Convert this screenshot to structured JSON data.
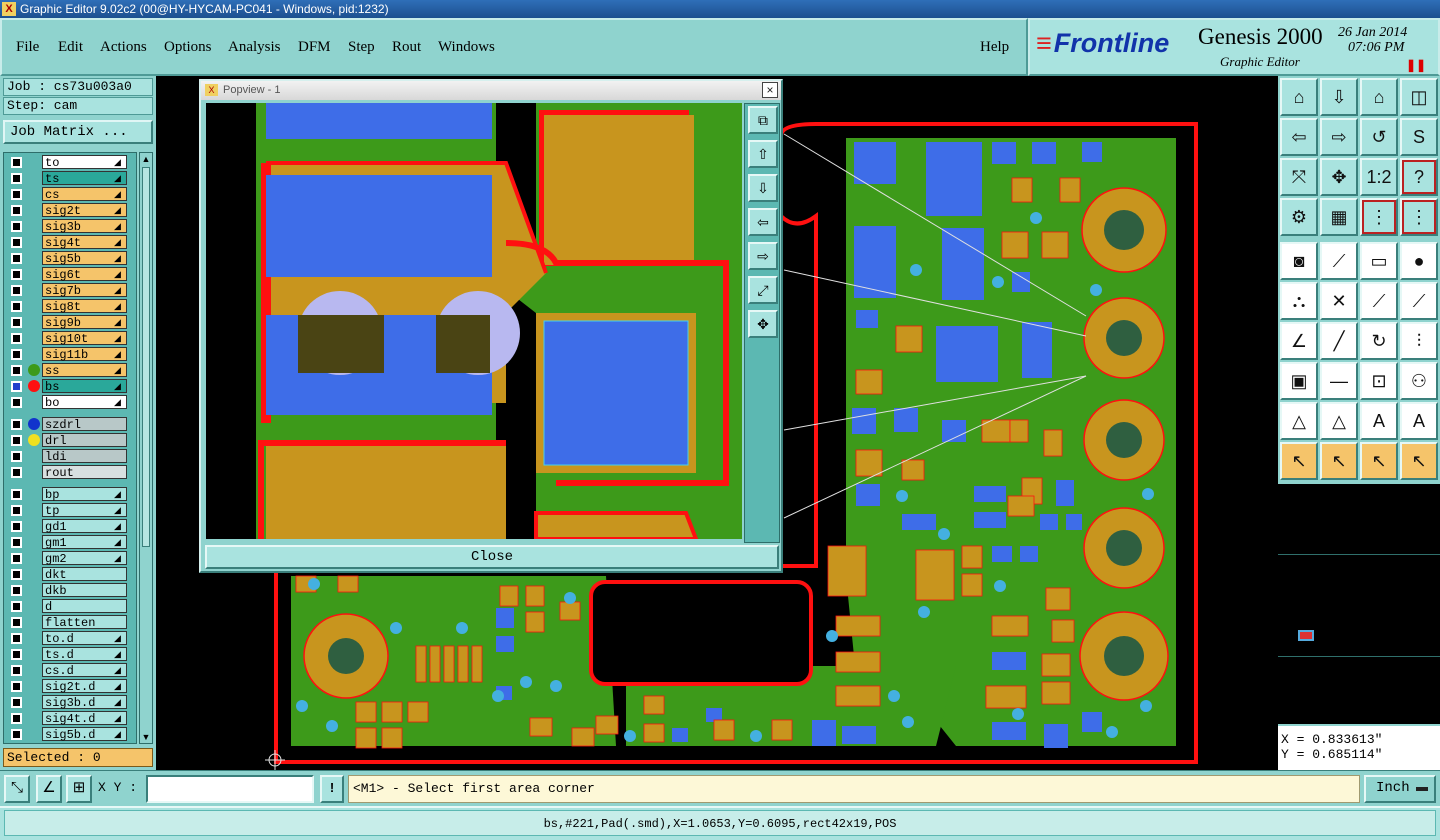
{
  "window": {
    "title": "Graphic Editor 9.02c2 (00@HY-HYCAM-PC041 - Windows, pid:1232)"
  },
  "menu": {
    "file": "File",
    "edit": "Edit",
    "actions": "Actions",
    "options": "Options",
    "analysis": "Analysis",
    "dfm": "DFM",
    "step": "Step",
    "rout": "Rout",
    "windows": "Windows",
    "help": "Help"
  },
  "brand": {
    "logo": "Frontline",
    "product": "Genesis 2000",
    "subtitle": "Graphic Editor",
    "date": "26 Jan 2014",
    "time": "07:06 PM"
  },
  "job": {
    "job_line": "Job : cs73u003a0",
    "step_line": "Step: cam",
    "matrix_button": "Job Matrix ..."
  },
  "layers": [
    {
      "name": "to",
      "color": "#ffffff"
    },
    {
      "name": "ts",
      "color": "#2aa89a"
    },
    {
      "name": "cs",
      "color": "#f5c46a"
    },
    {
      "name": "sig2t",
      "color": "#f5c46a"
    },
    {
      "name": "sig3b",
      "color": "#f5c46a"
    },
    {
      "name": "sig4t",
      "color": "#f5c46a"
    },
    {
      "name": "sig5b",
      "color": "#f5c46a"
    },
    {
      "name": "sig6t",
      "color": "#f5c46a"
    },
    {
      "name": "sig7b",
      "color": "#f5c46a"
    },
    {
      "name": "sig8t",
      "color": "#f5c46a"
    },
    {
      "name": "sig9b",
      "color": "#f5c46a"
    },
    {
      "name": "sig10t",
      "color": "#f5c46a"
    },
    {
      "name": "sig11b",
      "color": "#f5c46a"
    },
    {
      "name": "ss",
      "color": "#f5c46a"
    },
    {
      "name": "bs",
      "color": "#2aa89a"
    },
    {
      "name": "bo",
      "color": "#ffffff"
    },
    {
      "name": "szdrl",
      "color": "#b8c8c8"
    },
    {
      "name": "drl",
      "color": "#b8c8c8"
    },
    {
      "name": "ldi",
      "color": "#b8c8c8"
    },
    {
      "name": "rout",
      "color": "#d8e0e0"
    },
    {
      "name": "bp",
      "color": "#a9e3df"
    },
    {
      "name": "tp",
      "color": "#a9e3df"
    },
    {
      "name": "gd1",
      "color": "#a9e3df"
    },
    {
      "name": "gm1",
      "color": "#a9e3df"
    },
    {
      "name": "gm2",
      "color": "#a9e3df"
    },
    {
      "name": "dkt",
      "color": "#a9e3df"
    },
    {
      "name": "dkb",
      "color": "#a9e3df"
    },
    {
      "name": "d",
      "color": "#a9e3df"
    },
    {
      "name": "flatten",
      "color": "#a9e3df"
    },
    {
      "name": "to.d",
      "color": "#a9e3df"
    },
    {
      "name": "ts.d",
      "color": "#a9e3df"
    },
    {
      "name": "cs.d",
      "color": "#a9e3df"
    },
    {
      "name": "sig2t.d",
      "color": "#a9e3df"
    },
    {
      "name": "sig3b.d",
      "color": "#a9e3df"
    },
    {
      "name": "sig4t.d",
      "color": "#a9e3df"
    },
    {
      "name": "sig5b.d",
      "color": "#a9e3df"
    }
  ],
  "selected": "Selected : 0",
  "popview": {
    "title": "Popview - 1",
    "close_label": "Close"
  },
  "coords": {
    "x": "X = 0.833613\"",
    "y": "Y = 0.685114\""
  },
  "bottom": {
    "xy_label": "X Y :",
    "xy_value": "",
    "prompt": "<M1> - Select first area corner",
    "units": "Inch"
  },
  "status": "bs,#221,Pad(.smd),X=1.0653,Y=0.6095,rect42x19,POS",
  "colors": {
    "copper": "#c8951e",
    "pad": "#3e6de8",
    "mask": "#3d9a1a",
    "outline": "#ff1010",
    "drill": "#44b0e0",
    "panel": "#8fd3ce"
  }
}
